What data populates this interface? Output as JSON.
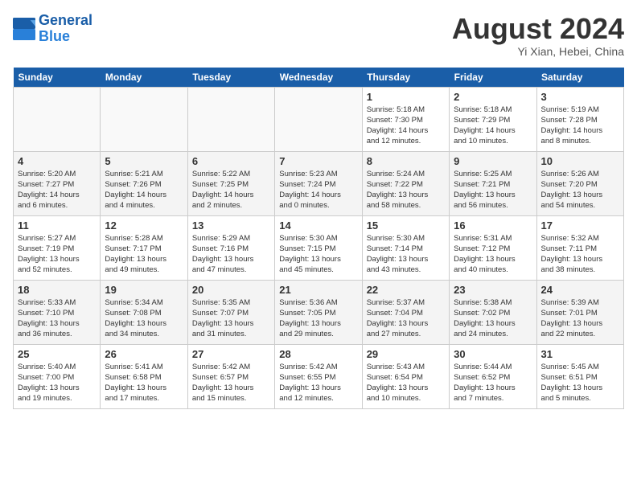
{
  "logo": {
    "line1": "General",
    "line2": "Blue"
  },
  "title": "August 2024",
  "location": "Yi Xian, Hebei, China",
  "weekdays": [
    "Sunday",
    "Monday",
    "Tuesday",
    "Wednesday",
    "Thursday",
    "Friday",
    "Saturday"
  ],
  "weeks": [
    [
      {
        "day": "",
        "info": ""
      },
      {
        "day": "",
        "info": ""
      },
      {
        "day": "",
        "info": ""
      },
      {
        "day": "",
        "info": ""
      },
      {
        "day": "1",
        "info": "Sunrise: 5:18 AM\nSunset: 7:30 PM\nDaylight: 14 hours\nand 12 minutes."
      },
      {
        "day": "2",
        "info": "Sunrise: 5:18 AM\nSunset: 7:29 PM\nDaylight: 14 hours\nand 10 minutes."
      },
      {
        "day": "3",
        "info": "Sunrise: 5:19 AM\nSunset: 7:28 PM\nDaylight: 14 hours\nand 8 minutes."
      }
    ],
    [
      {
        "day": "4",
        "info": "Sunrise: 5:20 AM\nSunset: 7:27 PM\nDaylight: 14 hours\nand 6 minutes."
      },
      {
        "day": "5",
        "info": "Sunrise: 5:21 AM\nSunset: 7:26 PM\nDaylight: 14 hours\nand 4 minutes."
      },
      {
        "day": "6",
        "info": "Sunrise: 5:22 AM\nSunset: 7:25 PM\nDaylight: 14 hours\nand 2 minutes."
      },
      {
        "day": "7",
        "info": "Sunrise: 5:23 AM\nSunset: 7:24 PM\nDaylight: 14 hours\nand 0 minutes."
      },
      {
        "day": "8",
        "info": "Sunrise: 5:24 AM\nSunset: 7:22 PM\nDaylight: 13 hours\nand 58 minutes."
      },
      {
        "day": "9",
        "info": "Sunrise: 5:25 AM\nSunset: 7:21 PM\nDaylight: 13 hours\nand 56 minutes."
      },
      {
        "day": "10",
        "info": "Sunrise: 5:26 AM\nSunset: 7:20 PM\nDaylight: 13 hours\nand 54 minutes."
      }
    ],
    [
      {
        "day": "11",
        "info": "Sunrise: 5:27 AM\nSunset: 7:19 PM\nDaylight: 13 hours\nand 52 minutes."
      },
      {
        "day": "12",
        "info": "Sunrise: 5:28 AM\nSunset: 7:17 PM\nDaylight: 13 hours\nand 49 minutes."
      },
      {
        "day": "13",
        "info": "Sunrise: 5:29 AM\nSunset: 7:16 PM\nDaylight: 13 hours\nand 47 minutes."
      },
      {
        "day": "14",
        "info": "Sunrise: 5:30 AM\nSunset: 7:15 PM\nDaylight: 13 hours\nand 45 minutes."
      },
      {
        "day": "15",
        "info": "Sunrise: 5:30 AM\nSunset: 7:14 PM\nDaylight: 13 hours\nand 43 minutes."
      },
      {
        "day": "16",
        "info": "Sunrise: 5:31 AM\nSunset: 7:12 PM\nDaylight: 13 hours\nand 40 minutes."
      },
      {
        "day": "17",
        "info": "Sunrise: 5:32 AM\nSunset: 7:11 PM\nDaylight: 13 hours\nand 38 minutes."
      }
    ],
    [
      {
        "day": "18",
        "info": "Sunrise: 5:33 AM\nSunset: 7:10 PM\nDaylight: 13 hours\nand 36 minutes."
      },
      {
        "day": "19",
        "info": "Sunrise: 5:34 AM\nSunset: 7:08 PM\nDaylight: 13 hours\nand 34 minutes."
      },
      {
        "day": "20",
        "info": "Sunrise: 5:35 AM\nSunset: 7:07 PM\nDaylight: 13 hours\nand 31 minutes."
      },
      {
        "day": "21",
        "info": "Sunrise: 5:36 AM\nSunset: 7:05 PM\nDaylight: 13 hours\nand 29 minutes."
      },
      {
        "day": "22",
        "info": "Sunrise: 5:37 AM\nSunset: 7:04 PM\nDaylight: 13 hours\nand 27 minutes."
      },
      {
        "day": "23",
        "info": "Sunrise: 5:38 AM\nSunset: 7:02 PM\nDaylight: 13 hours\nand 24 minutes."
      },
      {
        "day": "24",
        "info": "Sunrise: 5:39 AM\nSunset: 7:01 PM\nDaylight: 13 hours\nand 22 minutes."
      }
    ],
    [
      {
        "day": "25",
        "info": "Sunrise: 5:40 AM\nSunset: 7:00 PM\nDaylight: 13 hours\nand 19 minutes."
      },
      {
        "day": "26",
        "info": "Sunrise: 5:41 AM\nSunset: 6:58 PM\nDaylight: 13 hours\nand 17 minutes."
      },
      {
        "day": "27",
        "info": "Sunrise: 5:42 AM\nSunset: 6:57 PM\nDaylight: 13 hours\nand 15 minutes."
      },
      {
        "day": "28",
        "info": "Sunrise: 5:42 AM\nSunset: 6:55 PM\nDaylight: 13 hours\nand 12 minutes."
      },
      {
        "day": "29",
        "info": "Sunrise: 5:43 AM\nSunset: 6:54 PM\nDaylight: 13 hours\nand 10 minutes."
      },
      {
        "day": "30",
        "info": "Sunrise: 5:44 AM\nSunset: 6:52 PM\nDaylight: 13 hours\nand 7 minutes."
      },
      {
        "day": "31",
        "info": "Sunrise: 5:45 AM\nSunset: 6:51 PM\nDaylight: 13 hours\nand 5 minutes."
      }
    ]
  ]
}
